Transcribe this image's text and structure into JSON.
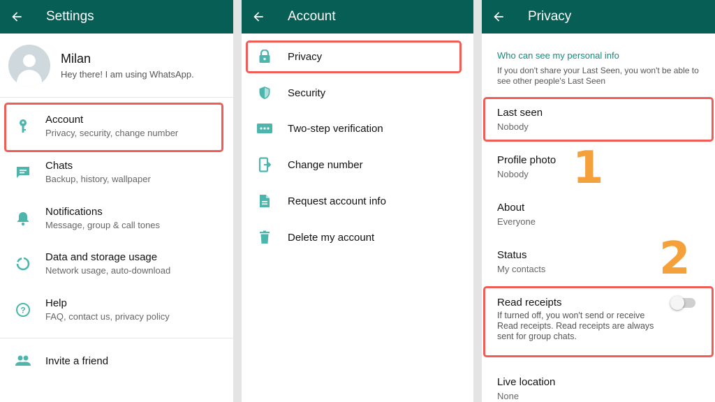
{
  "settings": {
    "title": "Settings",
    "profile": {
      "name": "Milan",
      "status": "Hey there! I am using WhatsApp."
    },
    "items": [
      {
        "label": "Account",
        "sub": "Privacy, security, change number"
      },
      {
        "label": "Chats",
        "sub": "Backup, history, wallpaper"
      },
      {
        "label": "Notifications",
        "sub": "Message, group & call tones"
      },
      {
        "label": "Data and storage usage",
        "sub": "Network usage, auto-download"
      },
      {
        "label": "Help",
        "sub": "FAQ, contact us, privacy policy"
      }
    ],
    "invite": "Invite a friend"
  },
  "account": {
    "title": "Account",
    "items": [
      {
        "label": "Privacy"
      },
      {
        "label": "Security"
      },
      {
        "label": "Two-step verification"
      },
      {
        "label": "Change number"
      },
      {
        "label": "Request account info"
      },
      {
        "label": "Delete my account"
      }
    ]
  },
  "privacy": {
    "title": "Privacy",
    "section_header": "Who can see my personal info",
    "section_note": "If you don't share your Last Seen, you won't be able to see other people's Last Seen",
    "items": [
      {
        "label": "Last seen",
        "value": "Nobody"
      },
      {
        "label": "Profile photo",
        "value": "Nobody"
      },
      {
        "label": "About",
        "value": "Everyone"
      },
      {
        "label": "Status",
        "value": "My contacts"
      }
    ],
    "read_receipts": {
      "label": "Read receipts",
      "note": "If turned off, you won't send or receive Read receipts. Read receipts are always sent for group chats.",
      "enabled": false
    },
    "live_location": {
      "label": "Live location",
      "value": "None"
    }
  },
  "annotations": {
    "step1": "1",
    "step2": "2"
  },
  "colors": {
    "header": "#075e54",
    "accent": "#128c7e",
    "icon": "#4db6ac",
    "highlight": "#ef5d56",
    "step_number": "#f4a13b"
  }
}
